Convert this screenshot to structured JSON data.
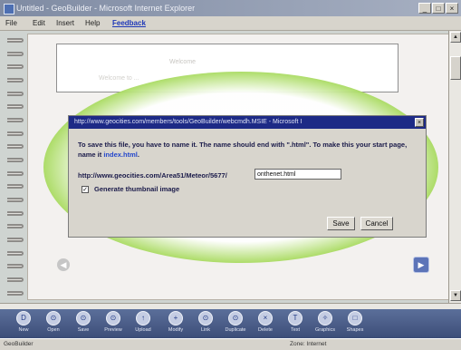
{
  "window": {
    "title": "Untitled - GeoBuilder - Microsoft Internet Explorer",
    "controls": [
      "_",
      "□",
      "×"
    ]
  },
  "menu": {
    "items": [
      "File",
      "Edit",
      "Insert",
      "Help"
    ],
    "feedback": "Feedback"
  },
  "canvas": {
    "ghost_text_1": "Welcome",
    "ghost_text_2": "Welcome to ..."
  },
  "dialog": {
    "title": "http://www.geocities.com/members/tools/GeoBuilder/webcmdh.MSIE - Microsoft I",
    "message_prefix": "To save this file, you have to name it. The name should end with \".html\". To make this your start page, name it ",
    "message_link": "index.html",
    "message_suffix": ".",
    "url_label": "http://www.geocities.com/Area51/Meteor/5677/",
    "filename_value": "onthenet.html",
    "checkbox_checked": true,
    "checkbox_mark": "✓",
    "checkbox_label": "Generate thumbnail image",
    "save_label": "Save",
    "cancel_label": "Cancel",
    "close_label": "×"
  },
  "nav": {
    "left_symbol": "◀",
    "right_symbol": "▶"
  },
  "toolbar": {
    "tools": [
      {
        "label": "New",
        "symbol": "D",
        "icon": "new-page-icon"
      },
      {
        "label": "Open",
        "symbol": "⊙",
        "icon": "open-icon"
      },
      {
        "label": "Save",
        "symbol": "⊙",
        "icon": "save-icon"
      },
      {
        "label": "Preview",
        "symbol": "⊙",
        "icon": "preview-icon"
      },
      {
        "label": "Upload",
        "symbol": "↑",
        "icon": "upload-icon"
      },
      {
        "label": "Modify",
        "symbol": "+",
        "icon": "modify-icon"
      },
      {
        "label": "Link",
        "symbol": "⊙",
        "icon": "link-icon"
      },
      {
        "label": "Duplicate",
        "symbol": "⊙",
        "icon": "duplicate-icon"
      },
      {
        "label": "Delete",
        "symbol": "×",
        "icon": "delete-icon"
      },
      {
        "label": "Text",
        "symbol": "T",
        "icon": "text-icon"
      },
      {
        "label": "Graphics",
        "symbol": "✧",
        "icon": "graphics-icon"
      },
      {
        "label": "Shapes",
        "symbol": "□",
        "icon": "shapes-icon"
      }
    ]
  },
  "status": {
    "left": "GeoBuilder",
    "right": "Zone: Internet"
  }
}
